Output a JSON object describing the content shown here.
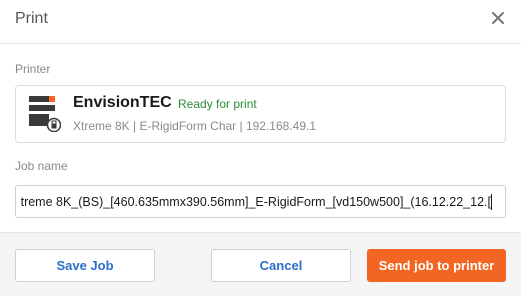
{
  "dialog": {
    "title": "Print",
    "close_icon": "close-icon"
  },
  "printer": {
    "section_label": "Printer",
    "name": "EnvisionTEC",
    "status": "Ready for print",
    "status_color": "#2e8b3a",
    "details": "Xtreme 8K | E-RigidForm Char | 192.168.49.1",
    "icon": "printer-icon"
  },
  "job": {
    "section_label": "Job name",
    "value": "treme 8K_(BS)_[460.635mmx390.56mm]_E-RigidForm_[vd150w500]_(16.12.22_12.["
  },
  "footer": {
    "save_label": "Save Job",
    "cancel_label": "Cancel",
    "send_label": "Send job to printer",
    "accent_color": "#f26522",
    "link_color": "#2a6fc9"
  }
}
